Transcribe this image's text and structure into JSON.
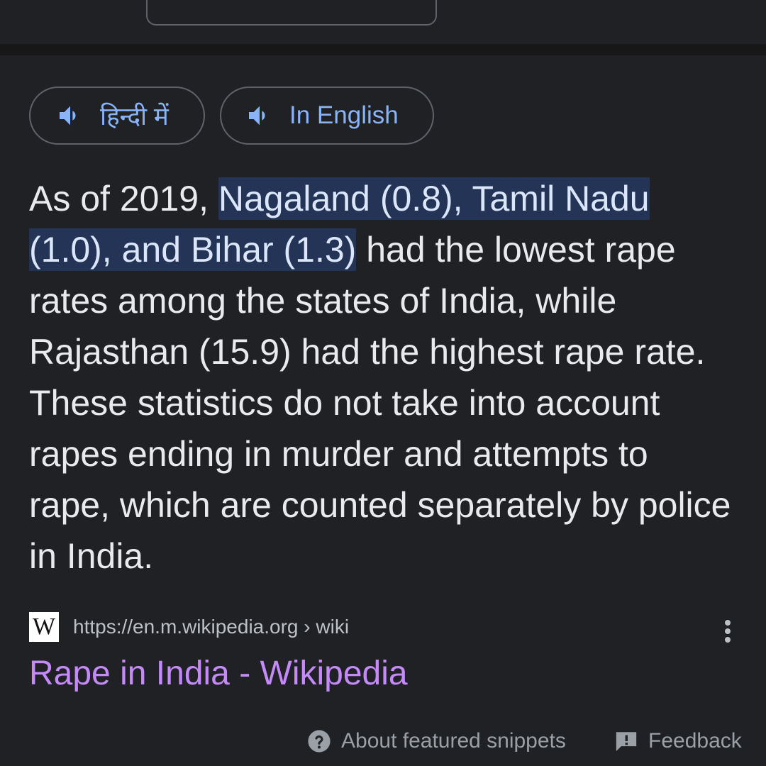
{
  "language_buttons": {
    "hindi": {
      "label": "हिन्दी में",
      "icon": "speaker-icon"
    },
    "english": {
      "label": "In English",
      "icon": "speaker-icon"
    }
  },
  "snippet": {
    "prefix": "As of 2019, ",
    "highlight": "Nagaland (0.8), Tamil Nadu (1.0), and Bihar (1.3)",
    "rest": " had the lowest rape rates among the states of India, while Rajasthan (15.9) had the highest rape rate. These statistics do not take into account rapes ending in murder and attempts to rape, which are counted separately by police in India."
  },
  "source": {
    "favicon_text": "W",
    "url": "https://en.m.wikipedia.org › wiki",
    "title": "Rape in India - Wikipedia",
    "more_icon": "more-vert-icon"
  },
  "footer": {
    "about": "About featured snippets",
    "feedback": "Feedback"
  },
  "colors": {
    "background": "#202124",
    "link_blue": "#8ab4f8",
    "visited_purple": "#c58af9",
    "highlight_bg": "#233456",
    "text": "#e8eaed",
    "muted": "#9aa0a6"
  }
}
